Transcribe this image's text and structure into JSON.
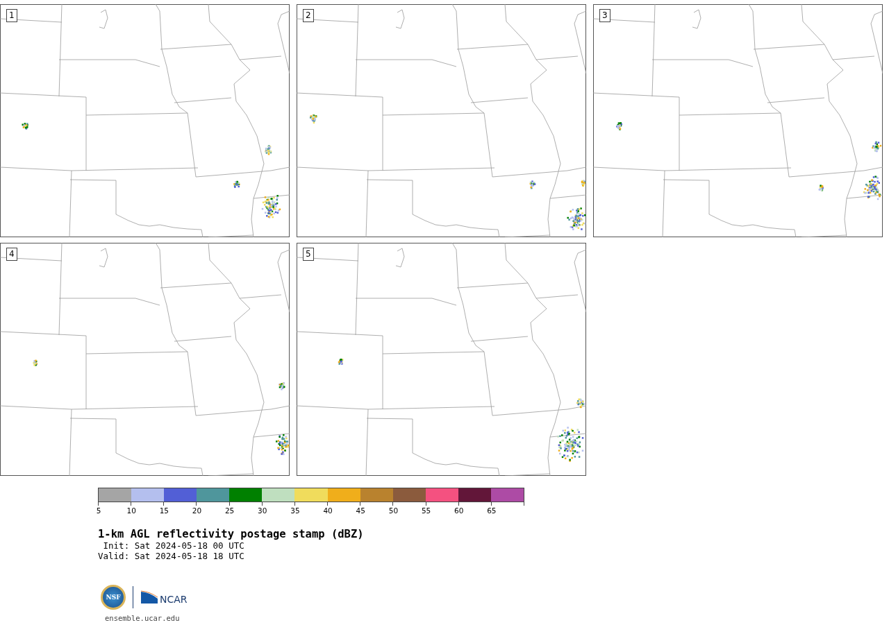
{
  "panels": [
    {
      "label": "1"
    },
    {
      "label": "2"
    },
    {
      "label": "3"
    },
    {
      "label": "4"
    },
    {
      "label": "5"
    }
  ],
  "colorbar": [
    {
      "label": "5",
      "color": "#a5a5a5"
    },
    {
      "label": "10",
      "color": "#b4bfee"
    },
    {
      "label": "15",
      "color": "#525fd6"
    },
    {
      "label": "20",
      "color": "#4f969c"
    },
    {
      "label": "25",
      "color": "#008000"
    },
    {
      "label": "30",
      "color": "#bfdfbf"
    },
    {
      "label": "35",
      "color": "#f0dc5c"
    },
    {
      "label": "40",
      "color": "#f0ae1b"
    },
    {
      "label": "45",
      "color": "#b9822e"
    },
    {
      "label": "50",
      "color": "#8b5b3d"
    },
    {
      "label": "55",
      "color": "#f45180"
    },
    {
      "label": "60",
      "color": "#621639"
    },
    {
      "label": "65",
      "color": "#ad4ba5"
    }
  ],
  "title": "1-km AGL reflectivity postage stamp (dBZ)",
  "init": " Init: Sat 2024-05-18 00 UTC",
  "valid": "Valid: Sat 2024-05-18 18 UTC",
  "logos": {
    "nsf": "NSF",
    "ncar": "NCAR"
  },
  "url": "ensemble.ucar.edu"
}
